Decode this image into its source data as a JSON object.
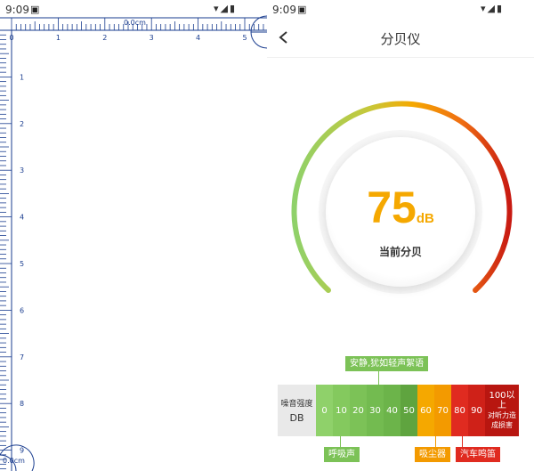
{
  "left_screen": {
    "status": {
      "time": "9:09"
    },
    "ruler": {
      "top_readout": "0.0cm",
      "bottom_readout": "0.0cm",
      "top_ticks": [
        "0",
        "1",
        "2",
        "3",
        "4",
        "5"
      ],
      "left_ticks": [
        "1",
        "2",
        "3",
        "4",
        "5",
        "6",
        "7",
        "8",
        "9"
      ],
      "accent": "#1a3d8f"
    }
  },
  "right_screen": {
    "status": {
      "time": "9:09"
    },
    "header": {
      "title": "分贝仪"
    },
    "gauge": {
      "value": "75",
      "unit": "dB",
      "caption": "当前分贝",
      "value_color": "#f5a800"
    },
    "scale": {
      "label_line1": "噪音强度",
      "label_line2": "DB",
      "segments": [
        {
          "label": "0",
          "color": "#8fd16a"
        },
        {
          "label": "10",
          "color": "#84c95e"
        },
        {
          "label": "20",
          "color": "#7cc257"
        },
        {
          "label": "30",
          "color": "#73bb50"
        },
        {
          "label": "40",
          "color": "#6cb44a"
        },
        {
          "label": "50",
          "color": "#5fa43f"
        },
        {
          "label": "60",
          "color": "#f5a800"
        },
        {
          "label": "70",
          "color": "#f39a00"
        },
        {
          "label": "80",
          "color": "#e02b20"
        },
        {
          "label": "90",
          "color": "#cf2118"
        },
        {
          "label": "100以上\n对听力造成损害",
          "color": "#b81610"
        }
      ],
      "tags": {
        "quiet": "安静,犹如轻声絮语",
        "breath": "呼吸声",
        "vacuum": "吸尘器",
        "horn": "汽车鸣笛"
      }
    }
  }
}
